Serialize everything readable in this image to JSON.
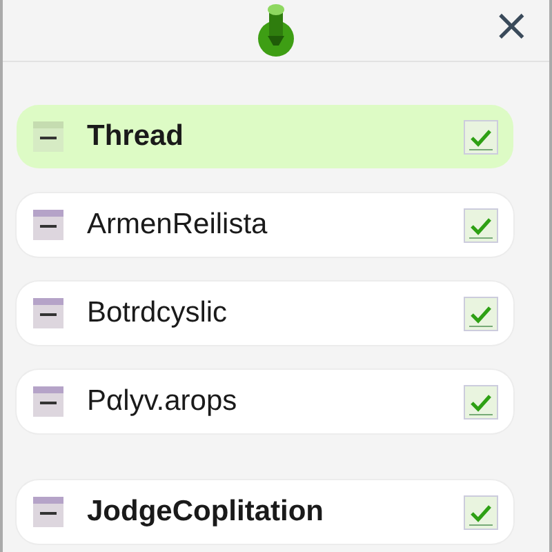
{
  "header": {
    "close": "×"
  },
  "sections": [
    {
      "items": [
        {
          "label": "Thread",
          "selected": true,
          "checked": true,
          "bold": true
        },
        {
          "label": "ArmenReilista",
          "selected": false,
          "checked": true,
          "bold": false
        },
        {
          "label": "Botrdcyslic",
          "selected": false,
          "checked": true,
          "bold": false
        },
        {
          "label": "Pαlyv.arops",
          "selected": false,
          "checked": true,
          "bold": false
        }
      ]
    },
    {
      "items": [
        {
          "label": "JodgeCoplitation",
          "selected": false,
          "checked": true,
          "bold": true
        }
      ]
    }
  ]
}
